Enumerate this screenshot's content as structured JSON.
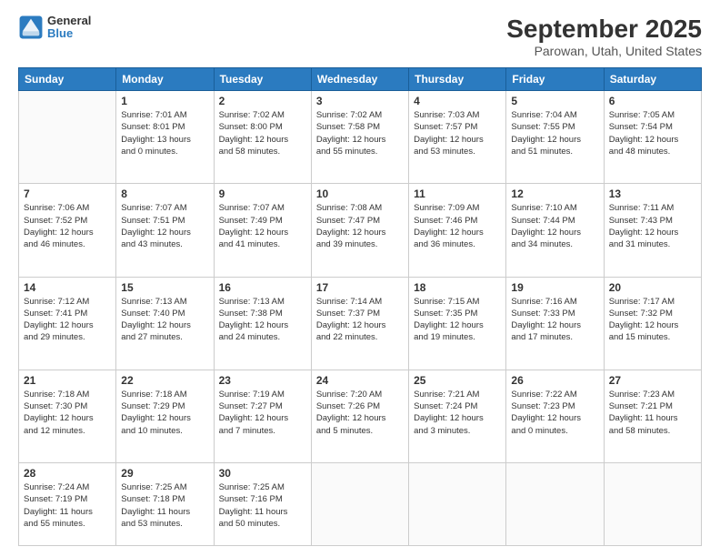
{
  "header": {
    "logo_line1": "General",
    "logo_line2": "Blue",
    "title": "September 2025",
    "subtitle": "Parowan, Utah, United States"
  },
  "weekdays": [
    "Sunday",
    "Monday",
    "Tuesday",
    "Wednesday",
    "Thursday",
    "Friday",
    "Saturday"
  ],
  "weeks": [
    [
      {
        "day": "",
        "info": ""
      },
      {
        "day": "1",
        "info": "Sunrise: 7:01 AM\nSunset: 8:01 PM\nDaylight: 13 hours\nand 0 minutes."
      },
      {
        "day": "2",
        "info": "Sunrise: 7:02 AM\nSunset: 8:00 PM\nDaylight: 12 hours\nand 58 minutes."
      },
      {
        "day": "3",
        "info": "Sunrise: 7:02 AM\nSunset: 7:58 PM\nDaylight: 12 hours\nand 55 minutes."
      },
      {
        "day": "4",
        "info": "Sunrise: 7:03 AM\nSunset: 7:57 PM\nDaylight: 12 hours\nand 53 minutes."
      },
      {
        "day": "5",
        "info": "Sunrise: 7:04 AM\nSunset: 7:55 PM\nDaylight: 12 hours\nand 51 minutes."
      },
      {
        "day": "6",
        "info": "Sunrise: 7:05 AM\nSunset: 7:54 PM\nDaylight: 12 hours\nand 48 minutes."
      }
    ],
    [
      {
        "day": "7",
        "info": "Sunrise: 7:06 AM\nSunset: 7:52 PM\nDaylight: 12 hours\nand 46 minutes."
      },
      {
        "day": "8",
        "info": "Sunrise: 7:07 AM\nSunset: 7:51 PM\nDaylight: 12 hours\nand 43 minutes."
      },
      {
        "day": "9",
        "info": "Sunrise: 7:07 AM\nSunset: 7:49 PM\nDaylight: 12 hours\nand 41 minutes."
      },
      {
        "day": "10",
        "info": "Sunrise: 7:08 AM\nSunset: 7:47 PM\nDaylight: 12 hours\nand 39 minutes."
      },
      {
        "day": "11",
        "info": "Sunrise: 7:09 AM\nSunset: 7:46 PM\nDaylight: 12 hours\nand 36 minutes."
      },
      {
        "day": "12",
        "info": "Sunrise: 7:10 AM\nSunset: 7:44 PM\nDaylight: 12 hours\nand 34 minutes."
      },
      {
        "day": "13",
        "info": "Sunrise: 7:11 AM\nSunset: 7:43 PM\nDaylight: 12 hours\nand 31 minutes."
      }
    ],
    [
      {
        "day": "14",
        "info": "Sunrise: 7:12 AM\nSunset: 7:41 PM\nDaylight: 12 hours\nand 29 minutes."
      },
      {
        "day": "15",
        "info": "Sunrise: 7:13 AM\nSunset: 7:40 PM\nDaylight: 12 hours\nand 27 minutes."
      },
      {
        "day": "16",
        "info": "Sunrise: 7:13 AM\nSunset: 7:38 PM\nDaylight: 12 hours\nand 24 minutes."
      },
      {
        "day": "17",
        "info": "Sunrise: 7:14 AM\nSunset: 7:37 PM\nDaylight: 12 hours\nand 22 minutes."
      },
      {
        "day": "18",
        "info": "Sunrise: 7:15 AM\nSunset: 7:35 PM\nDaylight: 12 hours\nand 19 minutes."
      },
      {
        "day": "19",
        "info": "Sunrise: 7:16 AM\nSunset: 7:33 PM\nDaylight: 12 hours\nand 17 minutes."
      },
      {
        "day": "20",
        "info": "Sunrise: 7:17 AM\nSunset: 7:32 PM\nDaylight: 12 hours\nand 15 minutes."
      }
    ],
    [
      {
        "day": "21",
        "info": "Sunrise: 7:18 AM\nSunset: 7:30 PM\nDaylight: 12 hours\nand 12 minutes."
      },
      {
        "day": "22",
        "info": "Sunrise: 7:18 AM\nSunset: 7:29 PM\nDaylight: 12 hours\nand 10 minutes."
      },
      {
        "day": "23",
        "info": "Sunrise: 7:19 AM\nSunset: 7:27 PM\nDaylight: 12 hours\nand 7 minutes."
      },
      {
        "day": "24",
        "info": "Sunrise: 7:20 AM\nSunset: 7:26 PM\nDaylight: 12 hours\nand 5 minutes."
      },
      {
        "day": "25",
        "info": "Sunrise: 7:21 AM\nSunset: 7:24 PM\nDaylight: 12 hours\nand 3 minutes."
      },
      {
        "day": "26",
        "info": "Sunrise: 7:22 AM\nSunset: 7:23 PM\nDaylight: 12 hours\nand 0 minutes."
      },
      {
        "day": "27",
        "info": "Sunrise: 7:23 AM\nSunset: 7:21 PM\nDaylight: 11 hours\nand 58 minutes."
      }
    ],
    [
      {
        "day": "28",
        "info": "Sunrise: 7:24 AM\nSunset: 7:19 PM\nDaylight: 11 hours\nand 55 minutes."
      },
      {
        "day": "29",
        "info": "Sunrise: 7:25 AM\nSunset: 7:18 PM\nDaylight: 11 hours\nand 53 minutes."
      },
      {
        "day": "30",
        "info": "Sunrise: 7:25 AM\nSunset: 7:16 PM\nDaylight: 11 hours\nand 50 minutes."
      },
      {
        "day": "",
        "info": ""
      },
      {
        "day": "",
        "info": ""
      },
      {
        "day": "",
        "info": ""
      },
      {
        "day": "",
        "info": ""
      }
    ]
  ]
}
